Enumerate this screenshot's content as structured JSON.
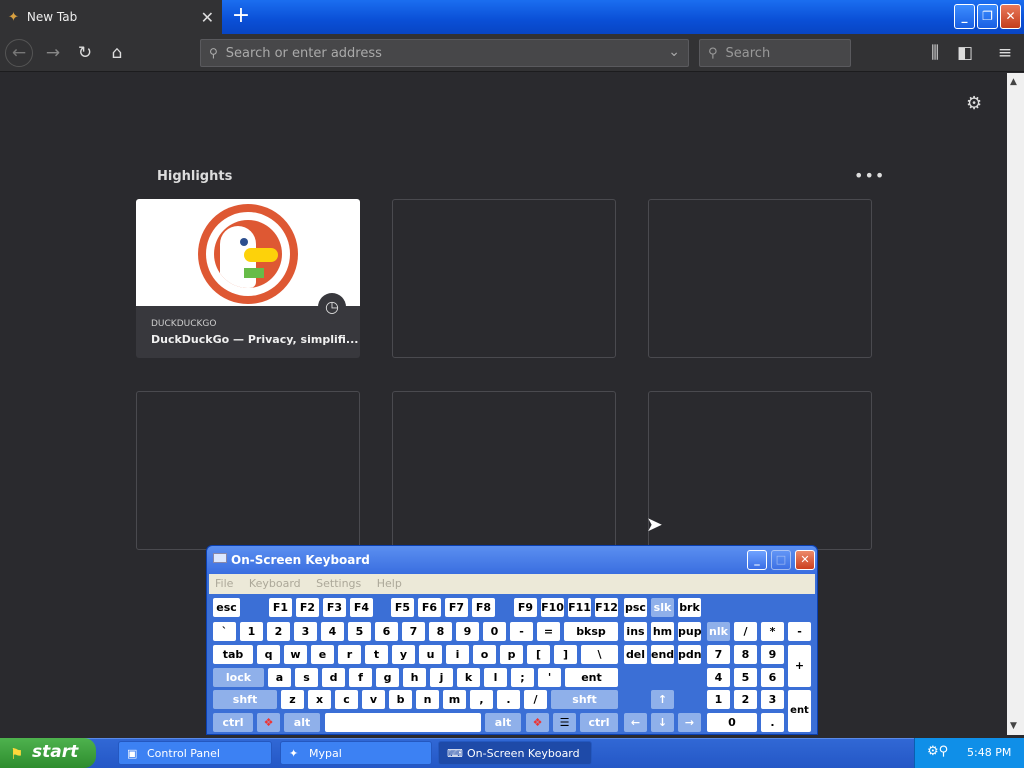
{
  "browser": {
    "tab_title": "New Tab",
    "new_tab_symbol": "+",
    "address_placeholder": "Search or enter address",
    "search_placeholder": "Search"
  },
  "newtab": {
    "highlights_label": "Highlights",
    "more_symbol": "•••",
    "cards": [
      {
        "source": "DUCKDUCKGO",
        "title": "DuckDuckGo — Privacy, simplifi..."
      }
    ]
  },
  "osk": {
    "title": "On-Screen Keyboard",
    "menu": [
      "File",
      "Keyboard",
      "Settings",
      "Help"
    ],
    "rows": [
      [
        "esc",
        "F1",
        "F2",
        "F3",
        "F4",
        "F5",
        "F6",
        "F7",
        "F8",
        "F9",
        "F10",
        "F11",
        "F12",
        "psc",
        "slk",
        "brk"
      ],
      [
        "`",
        "1",
        "2",
        "3",
        "4",
        "5",
        "6",
        "7",
        "8",
        "9",
        "0",
        "-",
        "=",
        "bksp",
        "ins",
        "hm",
        "pup",
        "nlk",
        "/",
        "*",
        "-"
      ],
      [
        "tab",
        "q",
        "w",
        "e",
        "r",
        "t",
        "y",
        "u",
        "i",
        "o",
        "p",
        "[",
        "]",
        "\\",
        "del",
        "end",
        "pdn",
        "7",
        "8",
        "9",
        "+"
      ],
      [
        "lock",
        "a",
        "s",
        "d",
        "f",
        "g",
        "h",
        "j",
        "k",
        "l",
        ";",
        "'",
        "ent",
        "4",
        "5",
        "6"
      ],
      [
        "shft",
        "z",
        "x",
        "c",
        "v",
        "b",
        "n",
        "m",
        ",",
        ".",
        "/",
        "shft",
        "↑",
        "1",
        "2",
        "3",
        "ent"
      ],
      [
        "ctrl",
        "alt",
        "alt",
        "ctrl",
        "←",
        "↓",
        "→",
        "0",
        "."
      ]
    ]
  },
  "taskbar": {
    "start_label": "start",
    "tasks": [
      "Control Panel",
      "Mypal",
      "On-Screen Keyboard"
    ],
    "clock": "5:48 PM"
  }
}
